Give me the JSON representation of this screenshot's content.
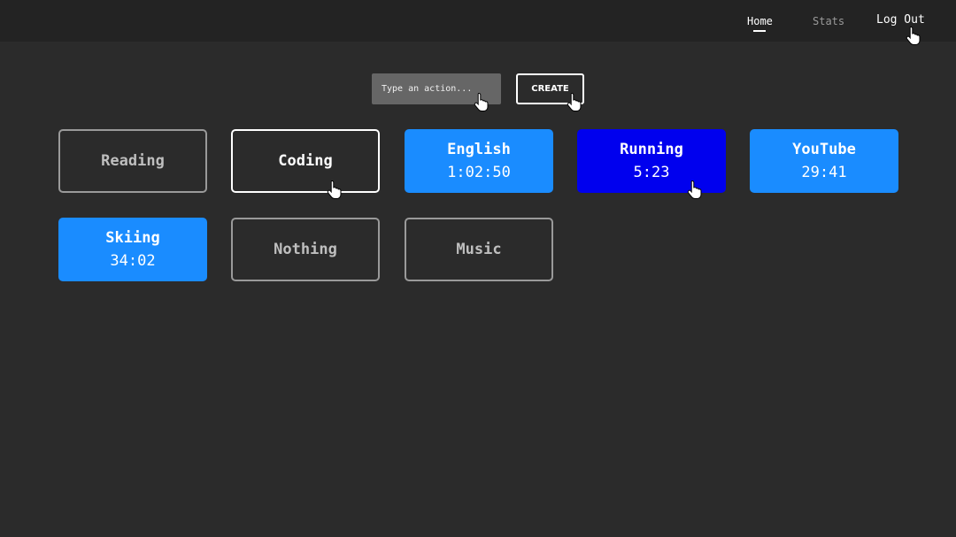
{
  "nav": {
    "home": "Home",
    "stats": "Stats",
    "logout": "Log Out"
  },
  "toolbar": {
    "input_placeholder": "Type an action...",
    "input_value": "",
    "create_label": "CREATE"
  },
  "activities": [
    {
      "name": "Reading",
      "time": "",
      "state": "idle"
    },
    {
      "name": "Coding",
      "time": "",
      "state": "hover"
    },
    {
      "name": "English",
      "time": "1:02:50",
      "state": "running"
    },
    {
      "name": "Running",
      "time": "5:23",
      "state": "focused"
    },
    {
      "name": "YouTube",
      "time": "29:41",
      "state": "running"
    },
    {
      "name": "Skiing",
      "time": "34:02",
      "state": "running"
    },
    {
      "name": "Nothing",
      "time": "",
      "state": "idle"
    },
    {
      "name": "Music",
      "time": "",
      "state": "idle"
    }
  ],
  "colors": {
    "background": "#2b2b2b",
    "topbar": "#232323",
    "running": "#1a8cff",
    "focused": "#0000ee",
    "input": "#666666"
  },
  "icons": {
    "cursor": "hand-pointer-icon"
  }
}
